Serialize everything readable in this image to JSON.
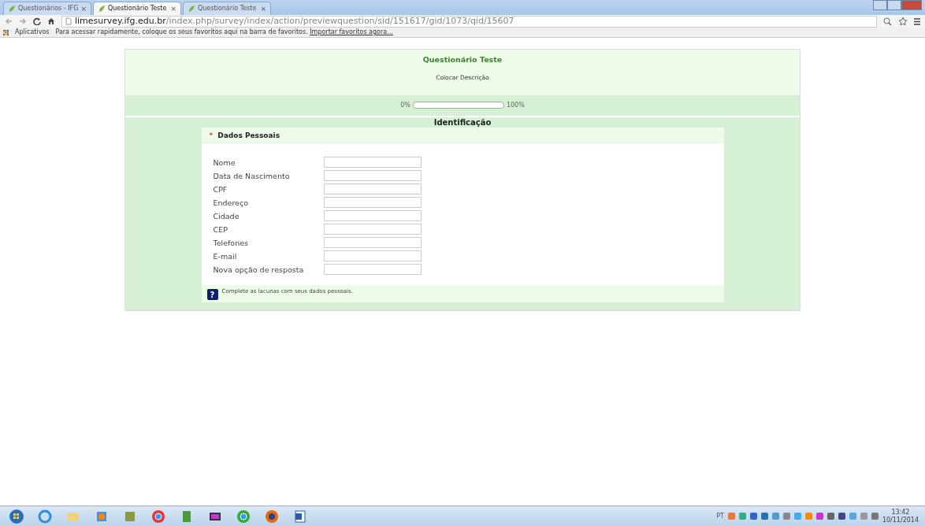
{
  "browser": {
    "tabs": [
      {
        "label": "Questionários - IFG",
        "selected": false,
        "close": "×"
      },
      {
        "label": "Questionário Teste",
        "selected": true,
        "close": "×"
      },
      {
        "label": "Questionário Teste",
        "selected": false,
        "close": "×"
      }
    ],
    "address": {
      "host": "limesurvey.ifg.edu.br",
      "path": "/index.php/survey/index/action/previewquestion/sid/151617/gid/1073/qid/15607"
    },
    "bookmarks_bar": {
      "apps": "Aplicativos",
      "hint": "Para acessar rapidamente, coloque os seus favoritos aqui na barra de favoritos.",
      "link": "Importar favoritos agora..."
    }
  },
  "survey": {
    "title": "Questionário Teste",
    "description": "Colocar Descrição",
    "progress": {
      "start": "0%",
      "end": "100%",
      "level": 0
    },
    "group_title": "Identificação",
    "question": {
      "required_mark": "*",
      "title": "Dados Pessoais",
      "fields": [
        {
          "label": "Nome"
        },
        {
          "label": "Data de Nascimento"
        },
        {
          "label": "CPF"
        },
        {
          "label": "Endereço"
        },
        {
          "label": "Cidade"
        },
        {
          "label": "CEP"
        },
        {
          "label": "Telefones"
        },
        {
          "label": "E-mail"
        },
        {
          "label": "Nova opção de resposta"
        }
      ],
      "help_glyph": "?",
      "help": "Complete as lacunas com seus dados pessoais."
    }
  },
  "taskbar": {
    "language": "PT",
    "time": "13:42",
    "date": "10/11/2014"
  }
}
